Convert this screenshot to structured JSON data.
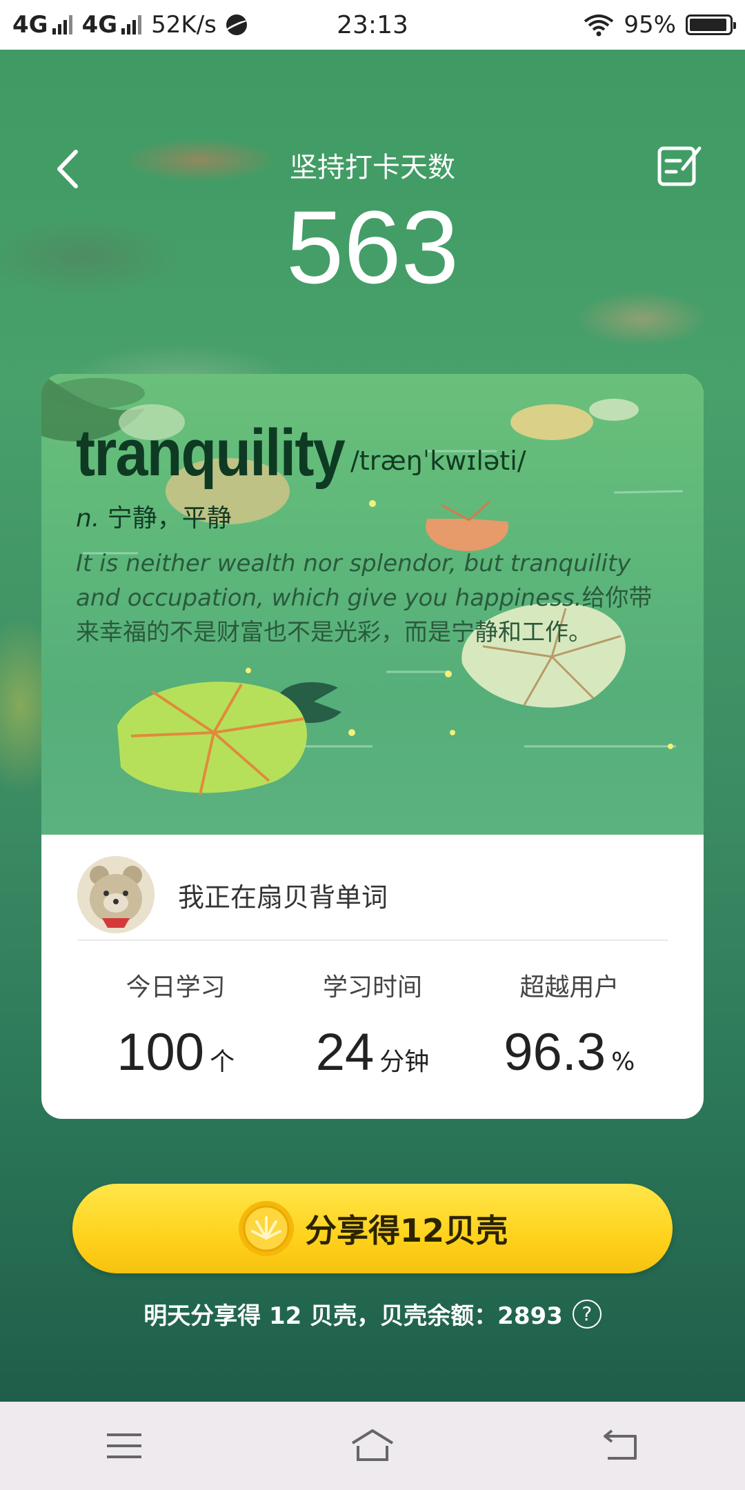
{
  "status_bar": {
    "network1": "4G",
    "network2": "4G",
    "speed": "52K/s",
    "time": "23:13",
    "battery_text": "95%",
    "battery_level": 0.95
  },
  "header": {
    "title": "坚持打卡天数",
    "streak_count": "563",
    "back_icon": "chevron-left-icon",
    "edit_icon": "edit-note-icon"
  },
  "card": {
    "word": "tranquility",
    "phonetic": "/træŋˈkwɪləti/",
    "part_of_speech": "n.",
    "definition": "宁静，平静",
    "example_en": "It is neither wealth nor splendor, but tranquility and occupation, which give you happiness.",
    "example_cn": "给你带来幸福的不是财富也不是光彩，而是宁静和工作。",
    "user_text": "我正在扇贝背单词",
    "stats": [
      {
        "label": "今日学习",
        "value": "100",
        "unit": "个"
      },
      {
        "label": "学习时间",
        "value": "24",
        "unit": "分钟"
      },
      {
        "label": "超越用户",
        "value": "96.3",
        "unit": "%"
      }
    ]
  },
  "share": {
    "button_label": "分享得12贝壳",
    "note": "明天分享得 12 贝壳，贝壳余额：2893",
    "help_icon": "question-circle-icon"
  },
  "nav": {
    "menu_icon": "menu-icon",
    "home_icon": "home-icon",
    "back_icon": "return-icon"
  },
  "colors": {
    "share_button": "#ffd21c",
    "background": "#3f9a63",
    "word_text": "#0e3a23"
  }
}
